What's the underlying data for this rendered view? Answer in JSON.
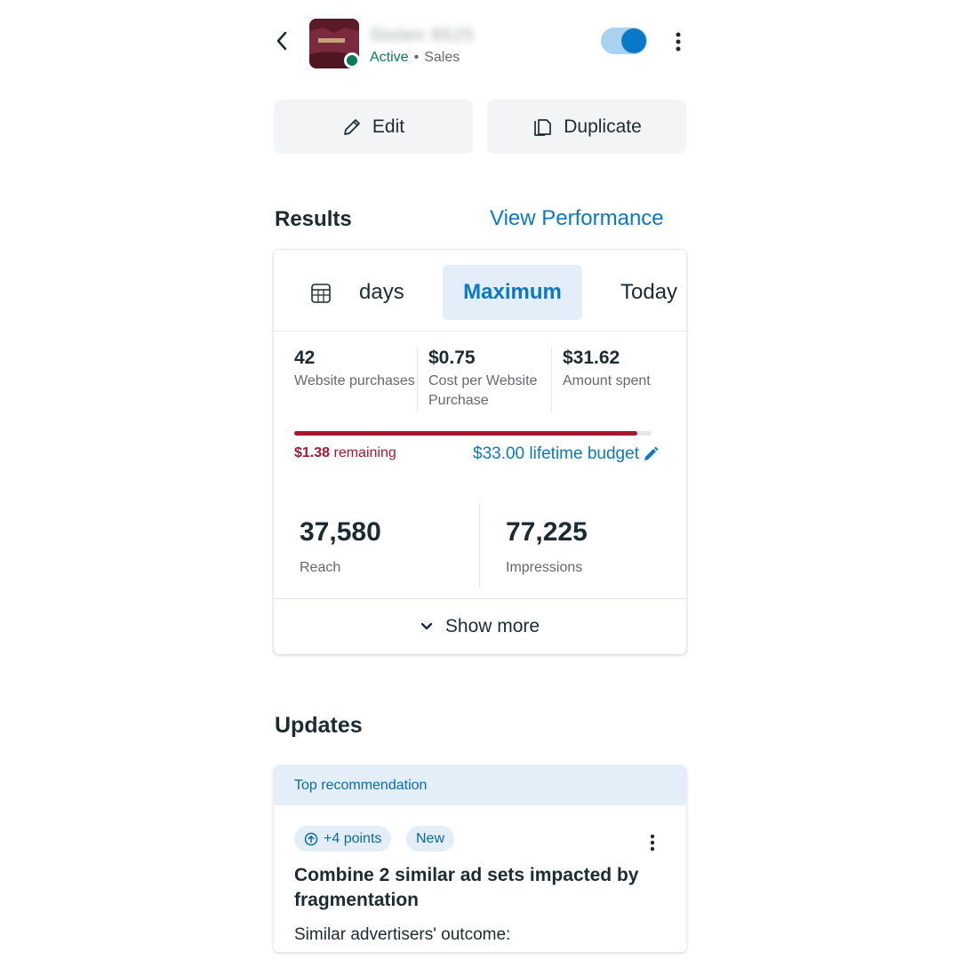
{
  "header": {
    "back_icon": "chevron-left-icon",
    "ad_name": "Stolen 8525",
    "status": "Active",
    "separator": "•",
    "objective": "Sales",
    "toggle_on": true,
    "more_icon": "more-vertical-icon"
  },
  "actions": {
    "edit_label": "Edit",
    "duplicate_label": "Duplicate"
  },
  "results": {
    "title": "Results",
    "view_performance": "View Performance",
    "ranges": [
      "days",
      "Maximum",
      "Today"
    ],
    "selected_range": "Maximum",
    "metrics": [
      {
        "value": "42",
        "label": "Website purchases"
      },
      {
        "value": "$0.75",
        "label": "Cost per Website Purchase"
      },
      {
        "value": "$31.62",
        "label": "Amount spent"
      }
    ],
    "budget": {
      "remaining_amount": "$1.38",
      "remaining_text": "remaining",
      "lifetime_label": "$33.00 lifetime budget",
      "spent_fraction": 0.96
    },
    "reach": {
      "value": "37,580",
      "label": "Reach"
    },
    "impressions": {
      "value": "77,225",
      "label": "Impressions"
    },
    "show_more": "Show more"
  },
  "updates": {
    "title": "Updates",
    "recommendation": {
      "header": "Top recommendation",
      "points_chip": "+4 points",
      "new_chip": "New",
      "title": "Combine 2 similar ad sets impacted by fragmentation",
      "subtitle": "Similar advertisers' outcome:"
    }
  },
  "colors": {
    "accent": "#0a78c8",
    "active_green": "#0a7b5a",
    "budget_red": "#a8172f",
    "chip_bg": "#e3eef8"
  }
}
